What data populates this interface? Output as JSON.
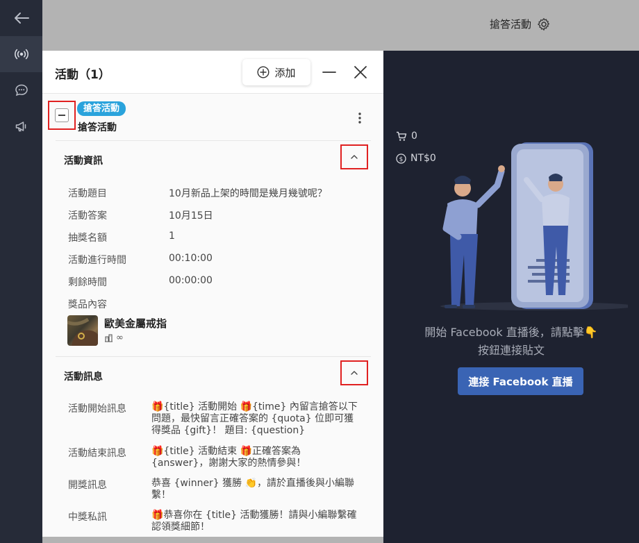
{
  "topbar": {
    "title": "搶答活動"
  },
  "panel": {
    "title": "活動（1）",
    "add_label": "添加",
    "activity": {
      "tag": "搶答活動",
      "name": "搶答活動"
    },
    "info": {
      "title": "活動資訊",
      "rows": [
        {
          "label": "活動題目",
          "value": "10月新品上架的時間是幾月幾號呢？"
        },
        {
          "label": "活動答案",
          "value": "10月15日"
        },
        {
          "label": "抽獎名額",
          "value": "1"
        },
        {
          "label": "活動進行時間",
          "value": "00:10:00"
        },
        {
          "label": "剩餘時間",
          "value": "00:00:00"
        }
      ],
      "prize_label": "獎品內容",
      "prize": {
        "name": "歐美金屬戒指",
        "qty": "∞"
      }
    },
    "messages": {
      "title": "活動訊息",
      "rows": [
        {
          "label": "活動開始訊息",
          "value": "🎁{title} 活動開始 🎁{time} 內留言搶答以下問題，最快留言正確答案的 {quota} 位即可獲得獎品 {gift}！ 題目: {question}"
        },
        {
          "label": "活動結束訊息",
          "value": "🎁{title} 活動結束 🎁正確答案為 {answer}，謝謝大家的熱情參與！"
        },
        {
          "label": "開獎訊息",
          "value": "恭喜 {winner} 獲勝 👏，請於直播後與小編聯繫！"
        },
        {
          "label": "中獎私訊",
          "value": "🎁恭喜你在 {title} 活動獲勝！請與小編聯繫確認領獎細節！"
        }
      ]
    }
  },
  "live": {
    "cart_count": "0",
    "amount": "NT$0",
    "hint_line1": "開始 Facebook 直播後，請點擊👇",
    "hint_line2": "按鈕連接貼文",
    "connect_label": "連接 Facebook 直播"
  },
  "colors": {
    "accent": "#3a64b4",
    "tag": "#2aa3dc",
    "highlight": "#e02020",
    "rail": "#262b38",
    "live_bg": "#1e2230"
  }
}
